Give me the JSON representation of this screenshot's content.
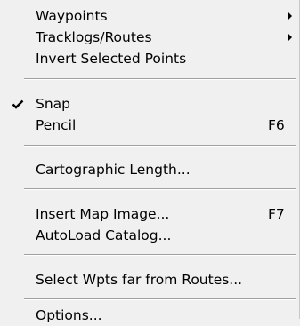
{
  "menu": {
    "items": [
      {
        "label": "Waypoints"
      },
      {
        "label": "Tracklogs/Routes"
      },
      {
        "label": "Invert Selected Points"
      },
      {
        "label": "Snap",
        "checked": true
      },
      {
        "label": "Pencil",
        "shortcut": "F6"
      },
      {
        "label": "Cartographic Length..."
      },
      {
        "label": "Insert Map Image...",
        "shortcut": "F7"
      },
      {
        "label": "AutoLoad Catalog..."
      },
      {
        "label": "Select Wpts far from Routes..."
      },
      {
        "label": "Options..."
      }
    ]
  }
}
